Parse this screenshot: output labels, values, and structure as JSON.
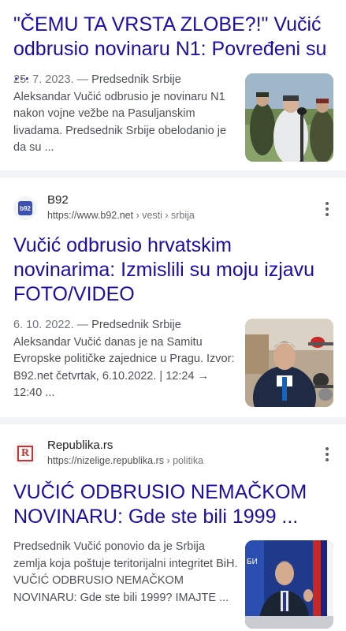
{
  "results": [
    {
      "title": "\"ČEMU TA VRSTA ZLOBE?!\" Vučić odbrusio novinaru N1: Povređeni su ...",
      "date": "25. 7. 2023. —",
      "snippet": "Predsednik Srbije Aleksandar Vučić odbrusio je novinaru N1 nakon vojne vežbe na Pasuljanskim livadama. Predsednik Srbije obelodanio je da su ...",
      "thumb_icon": "outdoor-press-photo"
    },
    {
      "site_name": "B92",
      "url": "https://www.b92.net",
      "breadcrumb": " › vesti › srbija",
      "favicon_text": "b92",
      "title": "Vučić odbrusio hrvatskim novinarima: Izmislili su moju izjavu FOTO/VIDEO",
      "date": "6. 10. 2022. —",
      "snippet": "Predsednik Srbije Aleksandar Vučić danas je na Samitu Evropske političke zajednice u Pragu. Izvor: B92.net četvrtak, 6.10.2022. | 12:24 → 12:40 ...",
      "thumb_icon": "microphones-photo"
    },
    {
      "site_name": "Republika.rs",
      "url": "https://nizelige.republika.rs",
      "breadcrumb": " › politika",
      "favicon_text": "R",
      "title": "VUČIĆ ODBRUSIO NEMAČKOM NOVINARU: Gde ste bili 1999 ...",
      "snippet": "Predsednik Vučić ponovio da je Srbija zemlja koja poštuje teritorijalni integritet BiH. VUČIĆ ODBRUSIO NEMAČKOM NOVINARU: Gde ste bili 1999? IMAJTE ...",
      "thumb_icon": "podium-photo"
    }
  ],
  "colors": {
    "link": "#1a0dab",
    "snippet": "#4d5156",
    "separator": "#f1f3f4",
    "b92": "#3b4fb8",
    "republika": "#d32f2f"
  }
}
